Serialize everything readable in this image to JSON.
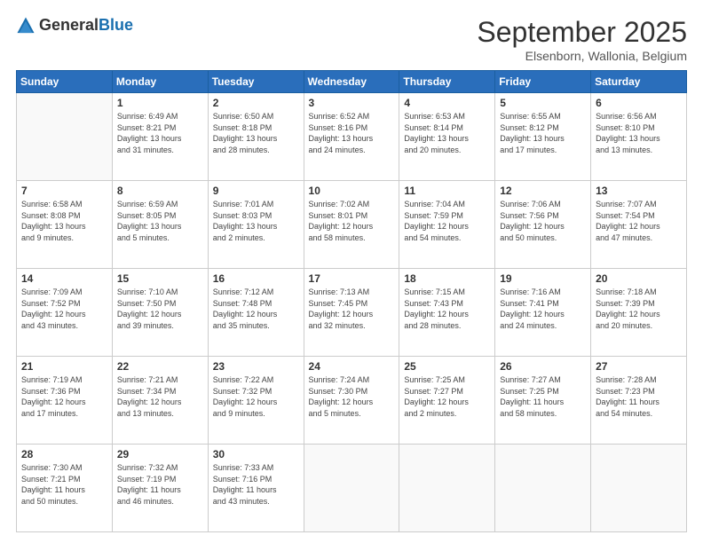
{
  "logo": {
    "general": "General",
    "blue": "Blue"
  },
  "title": "September 2025",
  "subtitle": "Elsenborn, Wallonia, Belgium",
  "days_header": [
    "Sunday",
    "Monday",
    "Tuesday",
    "Wednesday",
    "Thursday",
    "Friday",
    "Saturday"
  ],
  "weeks": [
    [
      {
        "day": "",
        "info": ""
      },
      {
        "day": "1",
        "info": "Sunrise: 6:49 AM\nSunset: 8:21 PM\nDaylight: 13 hours\nand 31 minutes."
      },
      {
        "day": "2",
        "info": "Sunrise: 6:50 AM\nSunset: 8:18 PM\nDaylight: 13 hours\nand 28 minutes."
      },
      {
        "day": "3",
        "info": "Sunrise: 6:52 AM\nSunset: 8:16 PM\nDaylight: 13 hours\nand 24 minutes."
      },
      {
        "day": "4",
        "info": "Sunrise: 6:53 AM\nSunset: 8:14 PM\nDaylight: 13 hours\nand 20 minutes."
      },
      {
        "day": "5",
        "info": "Sunrise: 6:55 AM\nSunset: 8:12 PM\nDaylight: 13 hours\nand 17 minutes."
      },
      {
        "day": "6",
        "info": "Sunrise: 6:56 AM\nSunset: 8:10 PM\nDaylight: 13 hours\nand 13 minutes."
      }
    ],
    [
      {
        "day": "7",
        "info": "Sunrise: 6:58 AM\nSunset: 8:08 PM\nDaylight: 13 hours\nand 9 minutes."
      },
      {
        "day": "8",
        "info": "Sunrise: 6:59 AM\nSunset: 8:05 PM\nDaylight: 13 hours\nand 5 minutes."
      },
      {
        "day": "9",
        "info": "Sunrise: 7:01 AM\nSunset: 8:03 PM\nDaylight: 13 hours\nand 2 minutes."
      },
      {
        "day": "10",
        "info": "Sunrise: 7:02 AM\nSunset: 8:01 PM\nDaylight: 12 hours\nand 58 minutes."
      },
      {
        "day": "11",
        "info": "Sunrise: 7:04 AM\nSunset: 7:59 PM\nDaylight: 12 hours\nand 54 minutes."
      },
      {
        "day": "12",
        "info": "Sunrise: 7:06 AM\nSunset: 7:56 PM\nDaylight: 12 hours\nand 50 minutes."
      },
      {
        "day": "13",
        "info": "Sunrise: 7:07 AM\nSunset: 7:54 PM\nDaylight: 12 hours\nand 47 minutes."
      }
    ],
    [
      {
        "day": "14",
        "info": "Sunrise: 7:09 AM\nSunset: 7:52 PM\nDaylight: 12 hours\nand 43 minutes."
      },
      {
        "day": "15",
        "info": "Sunrise: 7:10 AM\nSunset: 7:50 PM\nDaylight: 12 hours\nand 39 minutes."
      },
      {
        "day": "16",
        "info": "Sunrise: 7:12 AM\nSunset: 7:48 PM\nDaylight: 12 hours\nand 35 minutes."
      },
      {
        "day": "17",
        "info": "Sunrise: 7:13 AM\nSunset: 7:45 PM\nDaylight: 12 hours\nand 32 minutes."
      },
      {
        "day": "18",
        "info": "Sunrise: 7:15 AM\nSunset: 7:43 PM\nDaylight: 12 hours\nand 28 minutes."
      },
      {
        "day": "19",
        "info": "Sunrise: 7:16 AM\nSunset: 7:41 PM\nDaylight: 12 hours\nand 24 minutes."
      },
      {
        "day": "20",
        "info": "Sunrise: 7:18 AM\nSunset: 7:39 PM\nDaylight: 12 hours\nand 20 minutes."
      }
    ],
    [
      {
        "day": "21",
        "info": "Sunrise: 7:19 AM\nSunset: 7:36 PM\nDaylight: 12 hours\nand 17 minutes."
      },
      {
        "day": "22",
        "info": "Sunrise: 7:21 AM\nSunset: 7:34 PM\nDaylight: 12 hours\nand 13 minutes."
      },
      {
        "day": "23",
        "info": "Sunrise: 7:22 AM\nSunset: 7:32 PM\nDaylight: 12 hours\nand 9 minutes."
      },
      {
        "day": "24",
        "info": "Sunrise: 7:24 AM\nSunset: 7:30 PM\nDaylight: 12 hours\nand 5 minutes."
      },
      {
        "day": "25",
        "info": "Sunrise: 7:25 AM\nSunset: 7:27 PM\nDaylight: 12 hours\nand 2 minutes."
      },
      {
        "day": "26",
        "info": "Sunrise: 7:27 AM\nSunset: 7:25 PM\nDaylight: 11 hours\nand 58 minutes."
      },
      {
        "day": "27",
        "info": "Sunrise: 7:28 AM\nSunset: 7:23 PM\nDaylight: 11 hours\nand 54 minutes."
      }
    ],
    [
      {
        "day": "28",
        "info": "Sunrise: 7:30 AM\nSunset: 7:21 PM\nDaylight: 11 hours\nand 50 minutes."
      },
      {
        "day": "29",
        "info": "Sunrise: 7:32 AM\nSunset: 7:19 PM\nDaylight: 11 hours\nand 46 minutes."
      },
      {
        "day": "30",
        "info": "Sunrise: 7:33 AM\nSunset: 7:16 PM\nDaylight: 11 hours\nand 43 minutes."
      },
      {
        "day": "",
        "info": ""
      },
      {
        "day": "",
        "info": ""
      },
      {
        "day": "",
        "info": ""
      },
      {
        "day": "",
        "info": ""
      }
    ]
  ]
}
